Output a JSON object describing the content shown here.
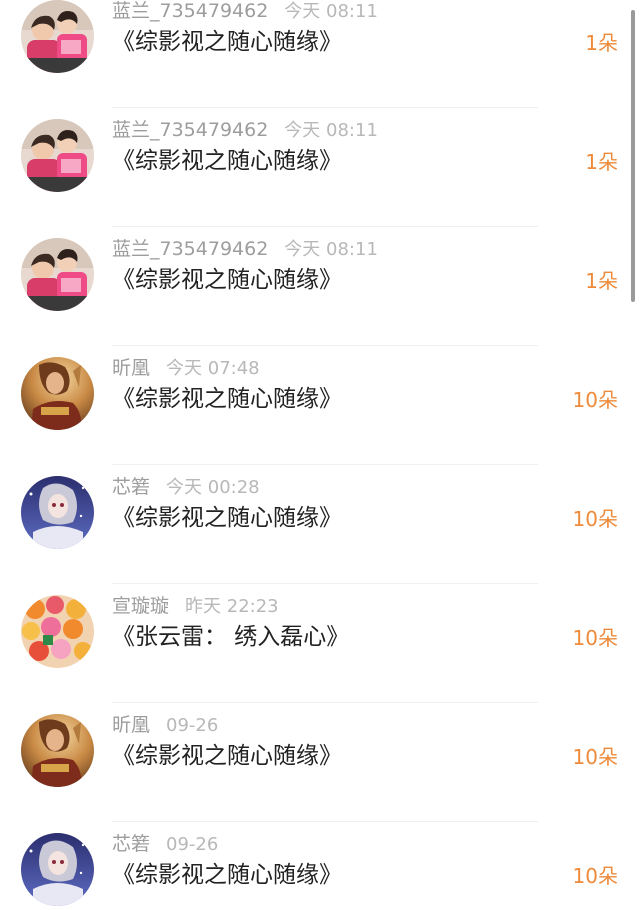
{
  "feed": {
    "items": [
      {
        "username": "蓝兰_735479462",
        "time": "今天 08:11",
        "title": "《综影视之随心随缘》",
        "count": "1朵",
        "avatar": "photo-avatar"
      },
      {
        "username": "蓝兰_735479462",
        "time": "今天 08:11",
        "title": "《综影视之随心随缘》",
        "count": "1朵",
        "avatar": "photo-avatar"
      },
      {
        "username": "蓝兰_735479462",
        "time": "今天 08:11",
        "title": "《综影视之随心随缘》",
        "count": "1朵",
        "avatar": "photo-avatar"
      },
      {
        "username": "昕凰",
        "time": "今天 07:48",
        "title": "《综影视之随心随缘》",
        "count": "10朵",
        "avatar": "warrior-avatar"
      },
      {
        "username": "芯箬",
        "time": "今天 00:28",
        "title": "《综影视之随心随缘》",
        "count": "10朵",
        "avatar": "anime-avatar"
      },
      {
        "username": "宣璇璇",
        "time": "昨天 22:23",
        "title": "《张云雷： 绣入磊心》",
        "count": "10朵",
        "avatar": "fruit-avatar"
      },
      {
        "username": "昕凰",
        "time": "09-26",
        "title": "《综影视之随心随缘》",
        "count": "10朵",
        "avatar": "warrior-avatar"
      },
      {
        "username": "芯箬",
        "time": "09-26",
        "title": "《综影视之随心随缘》",
        "count": "10朵",
        "avatar": "anime-avatar"
      }
    ]
  },
  "colors": {
    "count_accent": "#ee8a3a",
    "username": "#9d9d9d",
    "time": "#b8b8b8",
    "title": "#222222"
  }
}
